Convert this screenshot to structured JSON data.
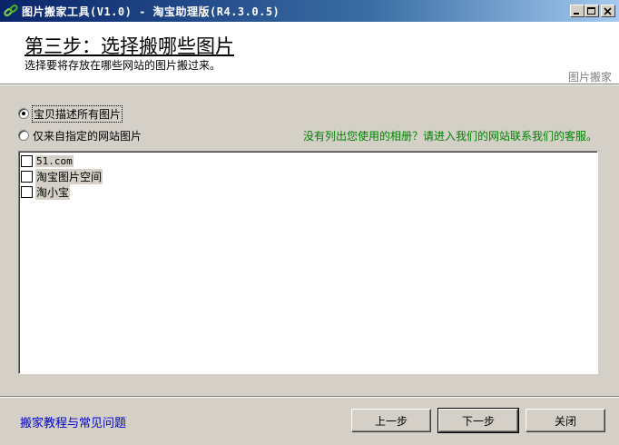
{
  "window": {
    "title": "图片搬家工具(V1.0) - 淘宝助理版(R4.3.0.5)",
    "controls": {
      "minimize": "_",
      "maximize": "□",
      "close": "×"
    }
  },
  "header": {
    "title": "第三步：选择搬哪些图片",
    "subtitle": "选择要将存放在哪些网站的图片搬过来。",
    "tag": "图片搬家"
  },
  "options": {
    "all_label": "宝贝描述所有图片",
    "specified_label": "仅来自指定的网站图片",
    "selected": "all"
  },
  "help_link": "没有列出您使用的相册？请进入我们的网站联系我们的客服。",
  "sites": [
    {
      "label": "51.com",
      "checked": false
    },
    {
      "label": "淘宝图片空间",
      "checked": false
    },
    {
      "label": "淘小宝",
      "checked": false
    }
  ],
  "footer": {
    "tutorial_link": "搬家教程与常见问题",
    "prev_button": "上一步",
    "next_button": "下一步",
    "close_button": "关闭"
  },
  "colors": {
    "title_bar": "#0a246a",
    "help_text": "#008000",
    "link": "#0000cc"
  }
}
